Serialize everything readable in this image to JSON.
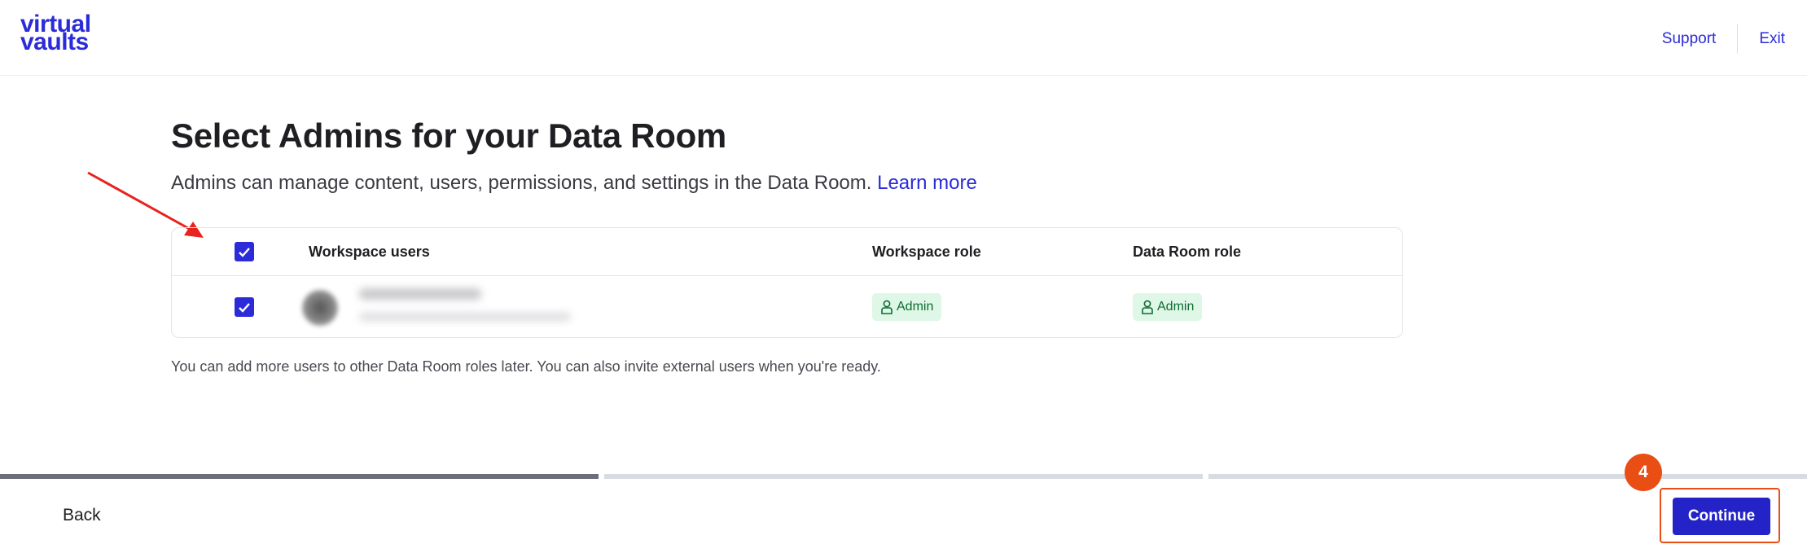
{
  "header": {
    "logo_line1": "virtual",
    "logo_line2": "vaults",
    "support_label": "Support",
    "exit_label": "Exit"
  },
  "main": {
    "title": "Select Admins for your Data Room",
    "subtitle": "Admins can manage content, users, permissions, and settings in the Data Room.",
    "learn_more": "Learn more",
    "table": {
      "headers": {
        "users": "Workspace users",
        "workspace_role": "Workspace role",
        "data_room_role": "Data Room role"
      },
      "rows": [
        {
          "selected": true,
          "workspace_role": "Admin",
          "data_room_role": "Admin"
        }
      ],
      "select_all": true
    },
    "note": "You can add more users to other Data Room roles later. You can also invite external users when you're ready."
  },
  "progress": {
    "steps_total": 3,
    "steps_completed": 1
  },
  "footer": {
    "back_label": "Back",
    "continue_label": "Continue",
    "step_badge": "4"
  },
  "colors": {
    "brand": "#2b2bd9",
    "annotation": "#e94e15",
    "badge_bg": "#dff7e6",
    "badge_text": "#0f6b34"
  }
}
